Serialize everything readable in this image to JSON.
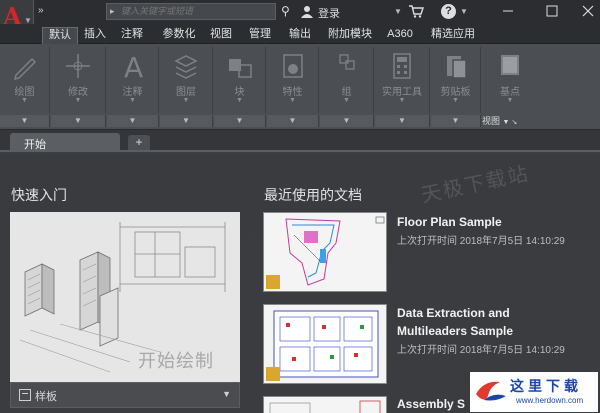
{
  "app": {
    "logo_letter": "A"
  },
  "titlebar": {
    "qat_more": "»",
    "search_placeholder": "键入关键字或短语",
    "login_label": "登录",
    "help_label": "?"
  },
  "ribbon_tabs": [
    {
      "label": "默认",
      "active": true
    },
    {
      "label": "插入"
    },
    {
      "label": "注释"
    },
    {
      "label": "参数化"
    },
    {
      "label": "视图"
    },
    {
      "label": "管理"
    },
    {
      "label": "输出"
    },
    {
      "label": "附加模块"
    },
    {
      "label": "A360"
    },
    {
      "label": "精选应用"
    }
  ],
  "ribbon_panels": [
    {
      "label": "绘图",
      "icon": "pencil-icon"
    },
    {
      "label": "修改",
      "icon": "move-icon"
    },
    {
      "label": "注释",
      "icon": "text-icon"
    },
    {
      "label": "图层",
      "icon": "layers-icon"
    },
    {
      "label": "块",
      "icon": "block-icon"
    },
    {
      "label": "特性",
      "icon": "properties-icon"
    },
    {
      "label": "组",
      "icon": "group-icon"
    },
    {
      "label": "实用工具",
      "icon": "calculator-icon"
    },
    {
      "label": "剪贴板",
      "icon": "clipboard-icon"
    },
    {
      "label": "基点",
      "icon": "basepoint-icon"
    }
  ],
  "view_panel_label": "视图",
  "doc_tabs": {
    "active_label": "开始",
    "add_label": "+"
  },
  "watermark": "天极下载站",
  "quick_start": {
    "title": "快速入门",
    "start_drawing": "开始绘制",
    "template_label": "样板"
  },
  "recent": {
    "title": "最近使用的文档",
    "items": [
      {
        "name": "Floor Plan Sample",
        "time": "上次打开时间 2018年7月5日 14:10:29"
      },
      {
        "name": "Data Extraction and Multileaders Sample",
        "time": "上次打开时间 2018年7月5日 14:10:29"
      },
      {
        "name": "Assembly S",
        "time": ""
      }
    ]
  },
  "site_logo": {
    "main": "这里下载",
    "url": "www.herdown.com"
  },
  "colors": {
    "brand_red": "#d8232a",
    "ribbon_bg": "#4b4e52",
    "title_bg": "#2b2d30",
    "logo_blue": "#1a47a6"
  }
}
